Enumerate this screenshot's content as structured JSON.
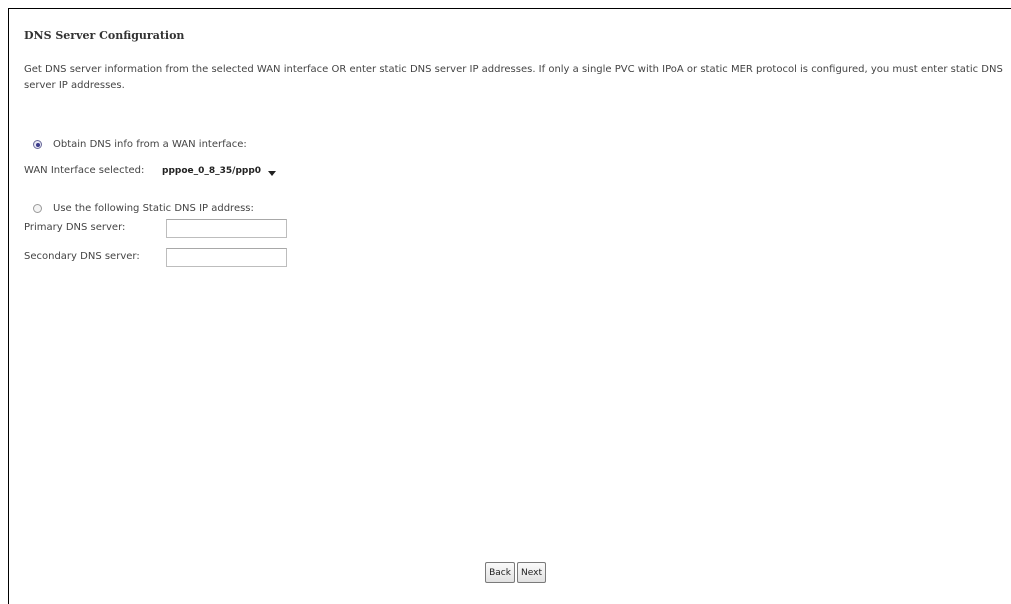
{
  "page": {
    "title": "DNS Server Configuration",
    "description": "Get DNS server information from the selected WAN interface OR enter static DNS server IP addresses. If only a single PVC with IPoA or static MER protocol is configured, you must enter static DNS server IP addresses."
  },
  "wan_option": {
    "label": "Obtain DNS info from a WAN interface:",
    "selected": true,
    "interface_label": "WAN Interface selected:",
    "interface_value": "pppoe_0_8_35/ppp0"
  },
  "static_option": {
    "label": "Use the following Static DNS IP address:",
    "selected": false,
    "primary_label": "Primary DNS server:",
    "primary_value": "",
    "secondary_label": "Secondary DNS server:",
    "secondary_value": ""
  },
  "buttons": {
    "back_label": "Back",
    "next_label": "Next"
  }
}
